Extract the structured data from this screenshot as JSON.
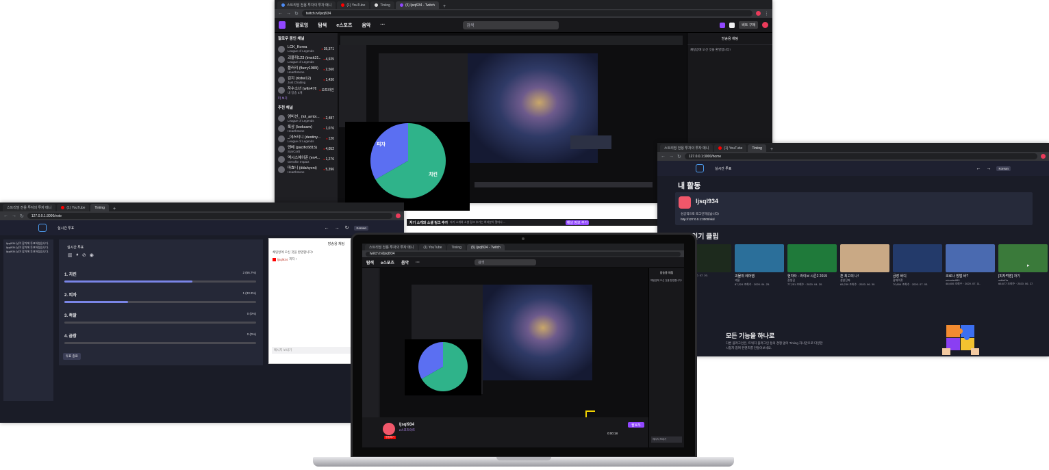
{
  "browser_tabs": {
    "twitch_window": [
      "스트리밍 전용 투자의 투자 매니",
      "(1) YouTube",
      "Tiniing",
      "(5) ljsql934 - Twitch"
    ],
    "tiniing_windows": [
      "스트리밍 전용 투자의 투자 매니",
      "(1) YouTube",
      "Tiniing"
    ],
    "new_tab": "+"
  },
  "twitch_window": {
    "url": "twitch.tv/ljsql934",
    "nav": {
      "following": "팔로잉",
      "browse": "탐색",
      "esports": "e스포츠",
      "music": "음악",
      "more": "···"
    },
    "search_placeholder": "검색",
    "bits_button": "비트 구매",
    "followed_title": "팔로우 중인 채널",
    "followed": [
      {
        "name": "LCK_Korea",
        "game": "League of Legends",
        "viewers": "35,371"
      },
      {
        "name": "괴물쥐123 (tmxk31...",
        "game": "League of Legends",
        "viewers": "4,925"
      },
      {
        "name": "플러리 (flurry1989)",
        "game": "Hearthstone",
        "viewers": "2,560"
      },
      {
        "name": "김지 (rkdwl12)",
        "game": "Just Chatting",
        "viewers": "1,430"
      },
      {
        "name": "자수소녀 (wltn476...",
        "game": "내 방송 5개",
        "viewers": "오프라인"
      }
    ],
    "show_more": "더 보기",
    "recommended_title": "추천 채널",
    "recommended": [
      {
        "name": "앰비션_ (lol_ambi...",
        "game": "League of Legends",
        "viewers": "2,487"
      },
      {
        "name": "룩삼 (looksam)",
        "game": "Hearthstone",
        "viewers": "1,076"
      },
      {
        "name": "_데스티니 (destiny...",
        "game": "League of Legends",
        "viewers": "120"
      },
      {
        "name": "엔베 (pacific6815)",
        "game": "StarCraft",
        "viewers": "4,052"
      },
      {
        "name": "엑시스에이준 (en4...",
        "game": "Genshin Impact",
        "viewers": "1,276"
      },
      {
        "name": "따효니 (ddahyoni)",
        "game": "Hearthstone",
        "viewers": "5,396"
      }
    ],
    "chat_title": "방송용 채팅",
    "chat_welcome": "채팅방에 오신 것을 환영합니다!",
    "stream_title": "자기 소개와 소셜 링크 추가",
    "stream_title_rest": "자기 소개와 소셜 링크 추가는 여러분이 얼마나 ...",
    "stream_button": "채널 정보 추가"
  },
  "pie_chart": {
    "labels": [
      "피자",
      "치킨"
    ],
    "colors": [
      "#5b6ff2",
      "#2fb38a"
    ]
  },
  "poll_window": {
    "url": "127.0.0.1:3000/vote",
    "header_title": "실시간 투표",
    "lang_select": "Korean",
    "chat_messages": [
      "ljsql934 님이 참가에 투표하셨습니다.",
      "ljsql934 님이 참가에 투표하셨습니다.",
      "ljsql934 님이 참가에 투표하셨습니다."
    ],
    "poll_title": "실시간 투표",
    "options": [
      {
        "label": "1.  치킨",
        "pct_text": "2 (66.7%)",
        "fill": 0.667
      },
      {
        "label": "2.  피자",
        "pct_text": "1 (33.3%)",
        "fill": 0.333
      },
      {
        "label": "3.  족발",
        "pct_text": "0 (0%)",
        "fill": 0
      },
      {
        "label": "4.  곱창",
        "pct_text": "0 (0%)",
        "fill": 0
      }
    ],
    "end_button": "투표 종료",
    "popup_title": "방송용 채팅",
    "popup_welcome": "채팅방에 오신 것을 환영합니다!",
    "popup_msg_user": "ljsql934",
    "popup_msg": "피자 !",
    "popup_input": "메시지 보내기"
  },
  "home_window": {
    "url": "127.0.0.1:3000/home",
    "header_title": "실시간 투표",
    "lang_select": "Korean",
    "my_activity": "내 활동",
    "username": "ljsql934",
    "status_text": "성공적으로 로그인하셨습니다!",
    "link": "http://127.0.0.1:3000/skd",
    "clips_title": "인기 클립",
    "clips": [
      {
        "title": "",
        "sub": "",
        "meta": "조회수 · 2020. 07. 20."
      },
      {
        "title": "괴물쥐 레어템",
        "sub": "괴물",
        "meta": "87,324 조회수 · 2020. 04. 25."
      },
      {
        "title": "현자타 - 라이브 시즌2 2019",
        "sub": "잘생김",
        "meta": "77,251 조회수 · 2020. 04. 20."
      },
      {
        "title": "혼 최고의 나!",
        "sub": "설날진짜",
        "meta": "65,239 조회수 · 2020. 06. 30."
      },
      {
        "title": "금장 바디",
        "sub": "잠재력찾",
        "meta": "70,604 조회수 · 2020. 07. 03."
      },
      {
        "title": "코로나 방법 바?",
        "sub": "mimaisdf89",
        "meta": "48,600 조회수 · 2020. 07. 11."
      },
      {
        "title": "[피자먹방] 자기",
        "sub": "wdlwf1s",
        "meta": "66,877 조회수 · 2020. 06. 27."
      }
    ],
    "feature_title": "모든 기능을 하나로",
    "feature_desc_1": "다른 플러그인은, 트위치 플러그인 등의 경쟁 없이 Tiniing 하나만으로 다양한",
    "feature_desc_2": "시청자 참여 컨텐츠를 만들어보세요."
  },
  "laptop_window": {
    "url": "twitch.tv/ljsql934",
    "username": "ljsql934",
    "category": "e스포츠이트",
    "follow_button": "팔로우",
    "live_badge": "방송하기",
    "chat_title": "방송용 채팅",
    "chat_welcome": "채팅방에 오신 것을 환영합니다!",
    "chat_input": "메시지 보내기",
    "viewers": "0:00:18"
  }
}
